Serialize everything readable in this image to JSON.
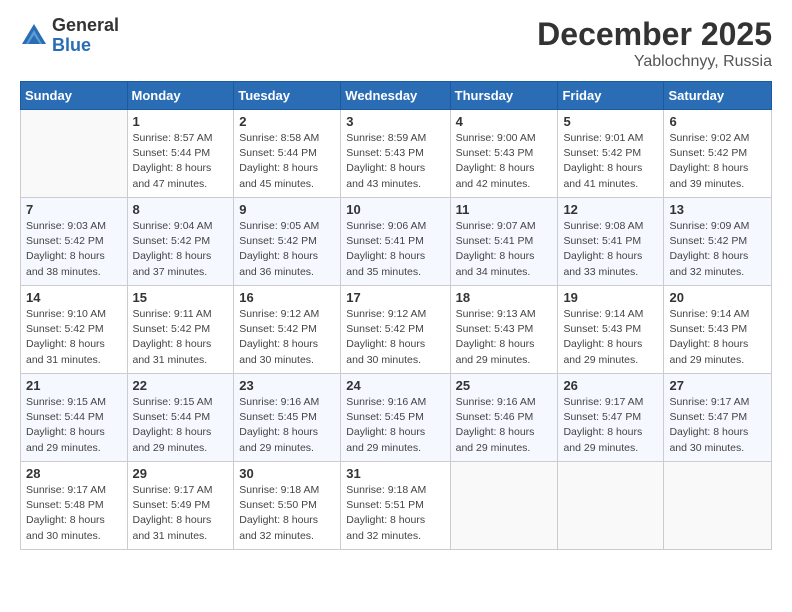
{
  "logo": {
    "general": "General",
    "blue": "Blue"
  },
  "title": "December 2025",
  "subtitle": "Yablochnyy, Russia",
  "days_header": [
    "Sunday",
    "Monday",
    "Tuesday",
    "Wednesday",
    "Thursday",
    "Friday",
    "Saturday"
  ],
  "weeks": [
    [
      {
        "day": "",
        "info": ""
      },
      {
        "day": "1",
        "info": "Sunrise: 8:57 AM\nSunset: 5:44 PM\nDaylight: 8 hours\nand 47 minutes."
      },
      {
        "day": "2",
        "info": "Sunrise: 8:58 AM\nSunset: 5:44 PM\nDaylight: 8 hours\nand 45 minutes."
      },
      {
        "day": "3",
        "info": "Sunrise: 8:59 AM\nSunset: 5:43 PM\nDaylight: 8 hours\nand 43 minutes."
      },
      {
        "day": "4",
        "info": "Sunrise: 9:00 AM\nSunset: 5:43 PM\nDaylight: 8 hours\nand 42 minutes."
      },
      {
        "day": "5",
        "info": "Sunrise: 9:01 AM\nSunset: 5:42 PM\nDaylight: 8 hours\nand 41 minutes."
      },
      {
        "day": "6",
        "info": "Sunrise: 9:02 AM\nSunset: 5:42 PM\nDaylight: 8 hours\nand 39 minutes."
      }
    ],
    [
      {
        "day": "7",
        "info": "Sunrise: 9:03 AM\nSunset: 5:42 PM\nDaylight: 8 hours\nand 38 minutes."
      },
      {
        "day": "8",
        "info": "Sunrise: 9:04 AM\nSunset: 5:42 PM\nDaylight: 8 hours\nand 37 minutes."
      },
      {
        "day": "9",
        "info": "Sunrise: 9:05 AM\nSunset: 5:42 PM\nDaylight: 8 hours\nand 36 minutes."
      },
      {
        "day": "10",
        "info": "Sunrise: 9:06 AM\nSunset: 5:41 PM\nDaylight: 8 hours\nand 35 minutes."
      },
      {
        "day": "11",
        "info": "Sunrise: 9:07 AM\nSunset: 5:41 PM\nDaylight: 8 hours\nand 34 minutes."
      },
      {
        "day": "12",
        "info": "Sunrise: 9:08 AM\nSunset: 5:41 PM\nDaylight: 8 hours\nand 33 minutes."
      },
      {
        "day": "13",
        "info": "Sunrise: 9:09 AM\nSunset: 5:42 PM\nDaylight: 8 hours\nand 32 minutes."
      }
    ],
    [
      {
        "day": "14",
        "info": "Sunrise: 9:10 AM\nSunset: 5:42 PM\nDaylight: 8 hours\nand 31 minutes."
      },
      {
        "day": "15",
        "info": "Sunrise: 9:11 AM\nSunset: 5:42 PM\nDaylight: 8 hours\nand 31 minutes."
      },
      {
        "day": "16",
        "info": "Sunrise: 9:12 AM\nSunset: 5:42 PM\nDaylight: 8 hours\nand 30 minutes."
      },
      {
        "day": "17",
        "info": "Sunrise: 9:12 AM\nSunset: 5:42 PM\nDaylight: 8 hours\nand 30 minutes."
      },
      {
        "day": "18",
        "info": "Sunrise: 9:13 AM\nSunset: 5:43 PM\nDaylight: 8 hours\nand 29 minutes."
      },
      {
        "day": "19",
        "info": "Sunrise: 9:14 AM\nSunset: 5:43 PM\nDaylight: 8 hours\nand 29 minutes."
      },
      {
        "day": "20",
        "info": "Sunrise: 9:14 AM\nSunset: 5:43 PM\nDaylight: 8 hours\nand 29 minutes."
      }
    ],
    [
      {
        "day": "21",
        "info": "Sunrise: 9:15 AM\nSunset: 5:44 PM\nDaylight: 8 hours\nand 29 minutes."
      },
      {
        "day": "22",
        "info": "Sunrise: 9:15 AM\nSunset: 5:44 PM\nDaylight: 8 hours\nand 29 minutes."
      },
      {
        "day": "23",
        "info": "Sunrise: 9:16 AM\nSunset: 5:45 PM\nDaylight: 8 hours\nand 29 minutes."
      },
      {
        "day": "24",
        "info": "Sunrise: 9:16 AM\nSunset: 5:45 PM\nDaylight: 8 hours\nand 29 minutes."
      },
      {
        "day": "25",
        "info": "Sunrise: 9:16 AM\nSunset: 5:46 PM\nDaylight: 8 hours\nand 29 minutes."
      },
      {
        "day": "26",
        "info": "Sunrise: 9:17 AM\nSunset: 5:47 PM\nDaylight: 8 hours\nand 29 minutes."
      },
      {
        "day": "27",
        "info": "Sunrise: 9:17 AM\nSunset: 5:47 PM\nDaylight: 8 hours\nand 30 minutes."
      }
    ],
    [
      {
        "day": "28",
        "info": "Sunrise: 9:17 AM\nSunset: 5:48 PM\nDaylight: 8 hours\nand 30 minutes."
      },
      {
        "day": "29",
        "info": "Sunrise: 9:17 AM\nSunset: 5:49 PM\nDaylight: 8 hours\nand 31 minutes."
      },
      {
        "day": "30",
        "info": "Sunrise: 9:18 AM\nSunset: 5:50 PM\nDaylight: 8 hours\nand 32 minutes."
      },
      {
        "day": "31",
        "info": "Sunrise: 9:18 AM\nSunset: 5:51 PM\nDaylight: 8 hours\nand 32 minutes."
      },
      {
        "day": "",
        "info": ""
      },
      {
        "day": "",
        "info": ""
      },
      {
        "day": "",
        "info": ""
      }
    ]
  ]
}
